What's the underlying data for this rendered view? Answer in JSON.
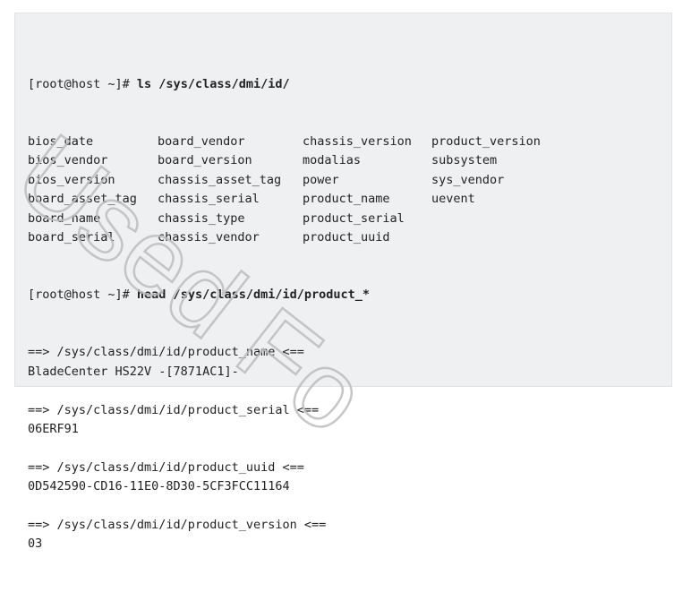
{
  "prompt": "[root@host ~]# ",
  "commands": {
    "ls": "ls /sys/class/dmi/id/",
    "head": "head /sys/class/dmi/id/product_*"
  },
  "ls_output": [
    [
      "bios_date",
      "board_vendor",
      "chassis_version",
      "product_version"
    ],
    [
      "bios_vendor",
      "board_version",
      "modalias",
      "subsystem"
    ],
    [
      "bios_version",
      "chassis_asset_tag",
      "power",
      "sys_vendor"
    ],
    [
      "board_asset_tag",
      "chassis_serial",
      "product_name",
      "uevent"
    ],
    [
      "board_name",
      "chassis_type",
      "product_serial",
      ""
    ],
    [
      "board_serial",
      "chassis_vendor",
      "product_uuid",
      ""
    ]
  ],
  "head_output": [
    "==> /sys/class/dmi/id/product_name <==",
    "BladeCenter HS22V -[7871AC1]-",
    "",
    "==> /sys/class/dmi/id/product_serial <==",
    "06ERF91",
    "",
    "==> /sys/class/dmi/id/product_uuid <==",
    "0D542590-CD16-11E0-8D30-5CF3FCC11164",
    "",
    "==> /sys/class/dmi/id/product_version <==",
    "03"
  ],
  "watermark": {
    "text": "Used Fo",
    "color": "#bdbdbd"
  },
  "colors": {
    "terminal_bg": "#eef0f2",
    "text": "#222222"
  }
}
